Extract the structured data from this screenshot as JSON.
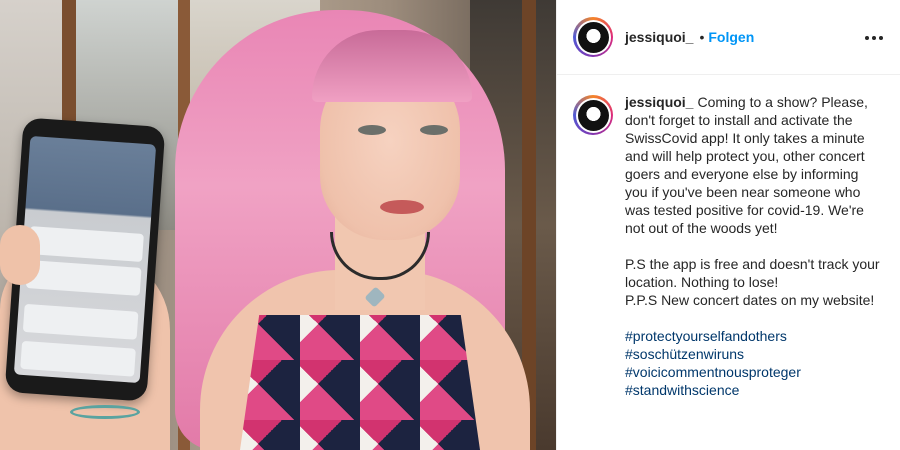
{
  "post": {
    "username": "jessiquoi_",
    "dot": "•",
    "follow_label": "Folgen",
    "more_icon": "more-horizontal-icon"
  },
  "caption": {
    "username": "jessiquoi_",
    "paragraph1": "Coming to a show? Please, don't forget to install and activate the SwissCovid app! It only takes a minute and will help protect you, other concert goers and everyone else by informing you if you've been near someone who was tested positive for covid-19. We're not out of the woods yet!",
    "paragraph2_line1": "P.S the app is free and doesn't track your location. Nothing to lose!",
    "paragraph2_line2": "P.P.S New concert dates on my website!",
    "hashtags": [
      "#protectyourselfandothers",
      "#soschützenwiruns",
      "#voicicommentnousproteger",
      "#standwithscience"
    ]
  }
}
